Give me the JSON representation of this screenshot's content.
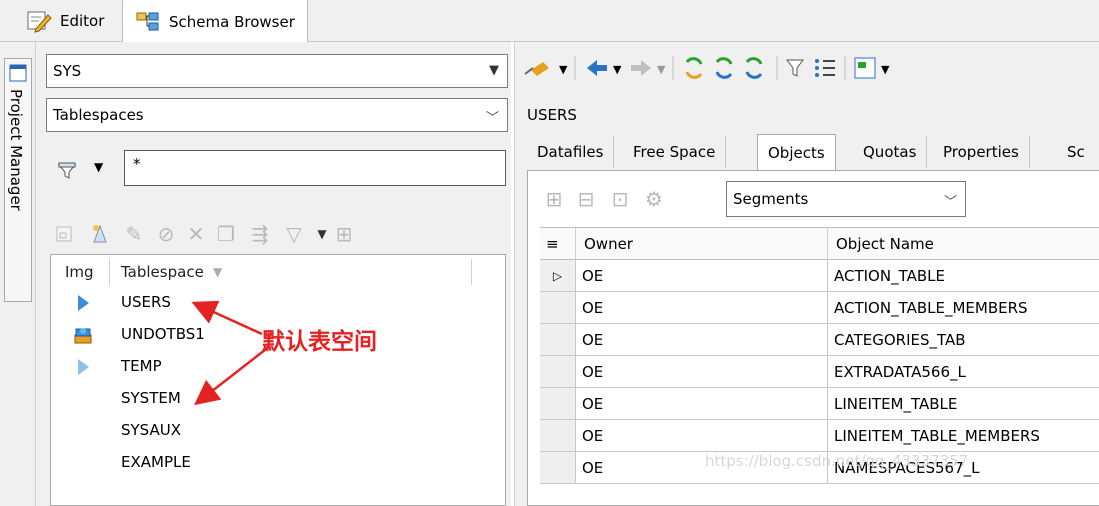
{
  "top_tabs": [
    {
      "label": "Editor",
      "icon": "edit-icon"
    },
    {
      "label": "Schema Browser",
      "icon": "schema-browser-icon"
    }
  ],
  "side_tab": {
    "label": "Project Manager"
  },
  "left": {
    "schema_select": {
      "value": "SYS"
    },
    "object_type_select": {
      "value": "Tablespaces"
    },
    "filter_input": {
      "value": "*"
    },
    "grid": {
      "columns": [
        "Img",
        "Tablespace"
      ],
      "rows": [
        {
          "name": "USERS",
          "icon": "blue-triangle"
        },
        {
          "name": "UNDOTBS1",
          "icon": "undo-stack"
        },
        {
          "name": "TEMP",
          "icon": "blue-triangle"
        },
        {
          "name": "SYSTEM",
          "icon": ""
        },
        {
          "name": "SYSAUX",
          "icon": ""
        },
        {
          "name": "EXAMPLE",
          "icon": ""
        }
      ]
    }
  },
  "annotation": {
    "text": "默认表空间",
    "color": "#e52222"
  },
  "right": {
    "object_title": "USERS",
    "tabs": [
      "Datafiles",
      "Free Space",
      "Objects",
      "Quotas",
      "Properties",
      "Sc"
    ],
    "active_tab": "Objects",
    "segment_select": {
      "value": "Segments"
    },
    "grid": {
      "columns": [
        "Owner",
        "Object Name"
      ],
      "rows": [
        {
          "owner": "OE",
          "object": "ACTION_TABLE"
        },
        {
          "owner": "OE",
          "object": "ACTION_TABLE_MEMBERS"
        },
        {
          "owner": "OE",
          "object": "CATEGORIES_TAB"
        },
        {
          "owner": "OE",
          "object": "EXTRADATA566_L"
        },
        {
          "owner": "OE",
          "object": "LINEITEM_TABLE"
        },
        {
          "owner": "OE",
          "object": "LINEITEM_TABLE_MEMBERS"
        },
        {
          "owner": "OE",
          "object": "NAMESPACES567_L"
        }
      ]
    }
  },
  "watermark": "https://blog.csdn.net/qq_43337357"
}
